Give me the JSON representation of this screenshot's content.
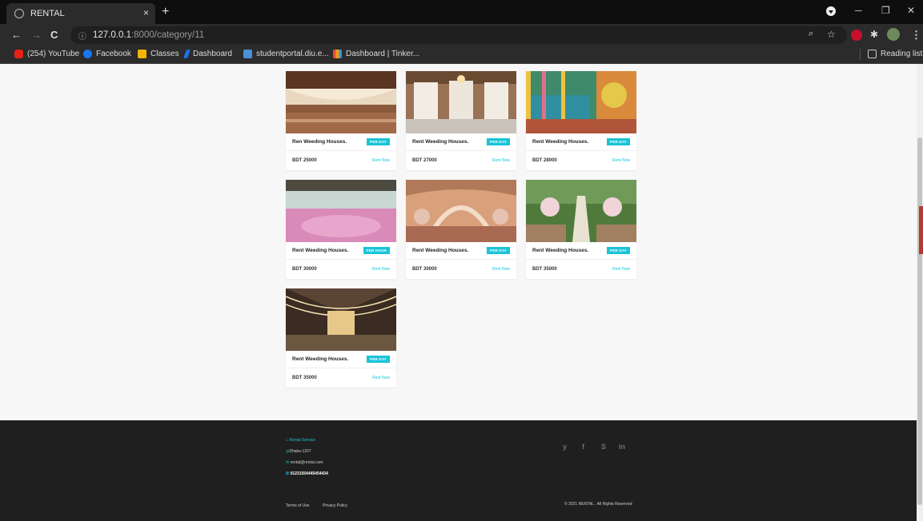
{
  "browser": {
    "tab_title": "RENTAL",
    "tab_close": "×",
    "new_tab": "+",
    "url_host": "127.0.0.1",
    "url_path": ":8000/category/11",
    "bookmarks": [
      "(254) YouTube",
      "Facebook",
      "Classes",
      "Dashboard",
      "studentportal.diu.e...",
      "Dashboard | Tinker..."
    ],
    "reading_list": "Reading list",
    "window_controls": [
      "─",
      "❐",
      "✕"
    ]
  },
  "listings": [
    {
      "title": "Ren Weeding Houses.",
      "badge": "PER DAY",
      "price": "BDT 25000",
      "action": "Rent Now"
    },
    {
      "title": "Rent Weeding Houses.",
      "badge": "PER DAY",
      "price": "BDT 27000",
      "action": "Rent Now"
    },
    {
      "title": "Rent Weeding Houses.",
      "badge": "PER DAY",
      "price": "BDT 28000",
      "action": "Rent Now"
    },
    {
      "title": "Rent Weeding Houses.",
      "badge": "PER HOUR",
      "price": "BDT 30000",
      "action": "Rent Now"
    },
    {
      "title": "Rent Weeding Houses.",
      "badge": "PER DAY",
      "price": "BDT 30000",
      "action": "Rent Now"
    },
    {
      "title": "Rent Weeding Houses.",
      "badge": "PER DAY",
      "price": "BDT 35000",
      "action": "Rent Now"
    },
    {
      "title": "Rent Weeding Houses.",
      "badge": "PER DAY",
      "price": "BDT 35000",
      "action": "Rent Now"
    }
  ],
  "footer": {
    "brand": "Rental Service",
    "address": "Dhaka-1207",
    "email": "rental@rental.com",
    "phone": "01231554445454434",
    "social": [
      "y",
      "f",
      "S",
      "in"
    ],
    "terms": "Terms of Use",
    "privacy": "Privacy Policy",
    "copyright": "© 2021 RENTAL . All Rights Reserved"
  },
  "colors": {
    "accent": "#19c4d8",
    "footer_bg": "#1f1f1f",
    "page_bg": "#f7f7f7"
  }
}
